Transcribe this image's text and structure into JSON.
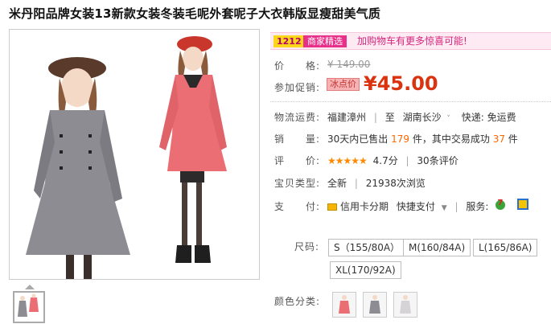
{
  "title": "米丹阳品牌女装13新款女装冬装毛呢外套呢子大衣韩版显瘦甜美气质",
  "promo_bar": {
    "tag1": "1212",
    "tag2": "商家精选",
    "text": "加购物车有更多惊喜可能!"
  },
  "price": {
    "label": "价　　格:",
    "original": "¥ 149.00"
  },
  "promotion": {
    "label": "参加促销:",
    "badge": "冰点价",
    "price": "¥45.00"
  },
  "shipping": {
    "label": "物流运费:",
    "from": "福建漳州",
    "to_prefix": "至",
    "to": "湖南长沙",
    "method": "快递: 免运费"
  },
  "sales": {
    "label": "销　　量:",
    "prefix": "30天内已售出",
    "count": "179",
    "mid": "件，其中交易成功",
    "success": "37",
    "suffix": "件"
  },
  "rating": {
    "label": "评　　价:",
    "stars": "★★★★★",
    "score": "4.7分",
    "reviews": "30条评价"
  },
  "product_type": {
    "label": "宝贝类型:",
    "condition": "全新",
    "views": "21938次浏览"
  },
  "payment": {
    "label": "支　　付:",
    "card": "信用卡分期",
    "quick": "快捷支付",
    "service_label": "服务:"
  },
  "size": {
    "label": "尺码:",
    "options": [
      "S（155/80A）",
      "M(160/84A)",
      "L(165/86A)",
      "XL(170/92A)"
    ]
  },
  "color": {
    "label": "颜色分类:"
  },
  "colors": {
    "accent_price": "#d9330f",
    "promo_pink": "#e8308a",
    "orange": "#ff6600"
  }
}
